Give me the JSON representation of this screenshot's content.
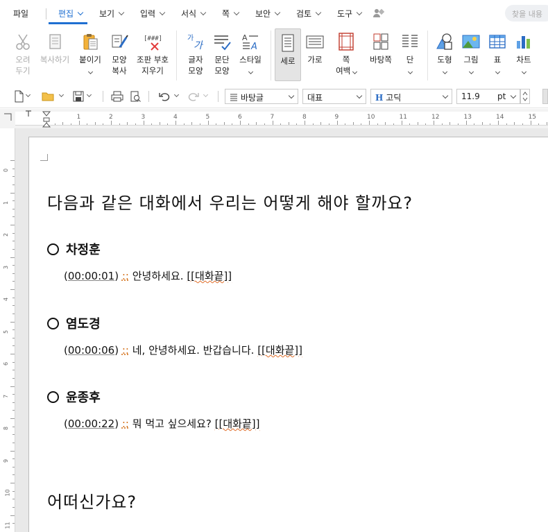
{
  "menu": {
    "items": [
      {
        "label": "파일",
        "chevron": false,
        "active": false
      },
      {
        "label": "편집",
        "chevron": true,
        "active": true
      },
      {
        "label": "보기",
        "chevron": true,
        "active": false
      },
      {
        "label": "입력",
        "chevron": true,
        "active": false
      },
      {
        "label": "서식",
        "chevron": true,
        "active": false
      },
      {
        "label": "쪽",
        "chevron": true,
        "active": false
      },
      {
        "label": "보안",
        "chevron": true,
        "active": false
      },
      {
        "label": "검토",
        "chevron": true,
        "active": false
      },
      {
        "label": "도구",
        "chevron": true,
        "active": false
      }
    ],
    "search_placeholder": "찾을 내용"
  },
  "ribbon": {
    "cut_1": "오려",
    "cut_2": "두기",
    "copy": "복사하기",
    "paste": "붙이기",
    "format_copy_1": "모양",
    "format_copy_2": "복사",
    "clear_marks_1": "조판 부호",
    "clear_marks_2": "지우기",
    "char_shape_1": "글자",
    "char_shape_2": "모양",
    "para_shape_1": "문단",
    "para_shape_2": "모양",
    "style": "스타일",
    "portrait": "세로",
    "landscape": "가로",
    "margin_1": "쪽",
    "margin_2": "여백",
    "background": "바탕쪽",
    "columns": "단",
    "shape": "도형",
    "picture": "그림",
    "table": "표",
    "chart": "차트"
  },
  "toolbar": {
    "style_name": "바탕글",
    "font_group": "대표",
    "font_name": "고딕",
    "font_size": "11.9",
    "font_unit": "pt"
  },
  "ruler": {
    "h_numbers": [
      "1",
      "2",
      "3",
      "4",
      "5",
      "6",
      "7",
      "8",
      "9",
      "10",
      "11",
      "12",
      "13",
      "14",
      "15"
    ],
    "v_numbers": [
      "0",
      "1",
      "2",
      "3",
      "4",
      "5",
      "6",
      "7",
      "8",
      "9",
      "10",
      "11"
    ]
  },
  "document": {
    "heading1": "다음과 같은 대화에서 우리는 어떻게 해야 할까요?",
    "blocks": [
      {
        "speaker": "차정훈",
        "time": "00:00:01",
        "sep": "::",
        "text": "안녕하세요.",
        "end": "[[대화끝]]"
      },
      {
        "speaker": "염도경",
        "time": "00:00:06",
        "sep": "::",
        "text": "네, 안녕하세요. 반갑습니다.",
        "end": "[[대화끝]]"
      },
      {
        "speaker": "윤종후",
        "time": "00:00:22",
        "sep": "::",
        "text": "뭐 먹고 싶으세요?",
        "end": "[[대화끝]]"
      }
    ],
    "heading2": "어떠신가요?"
  }
}
